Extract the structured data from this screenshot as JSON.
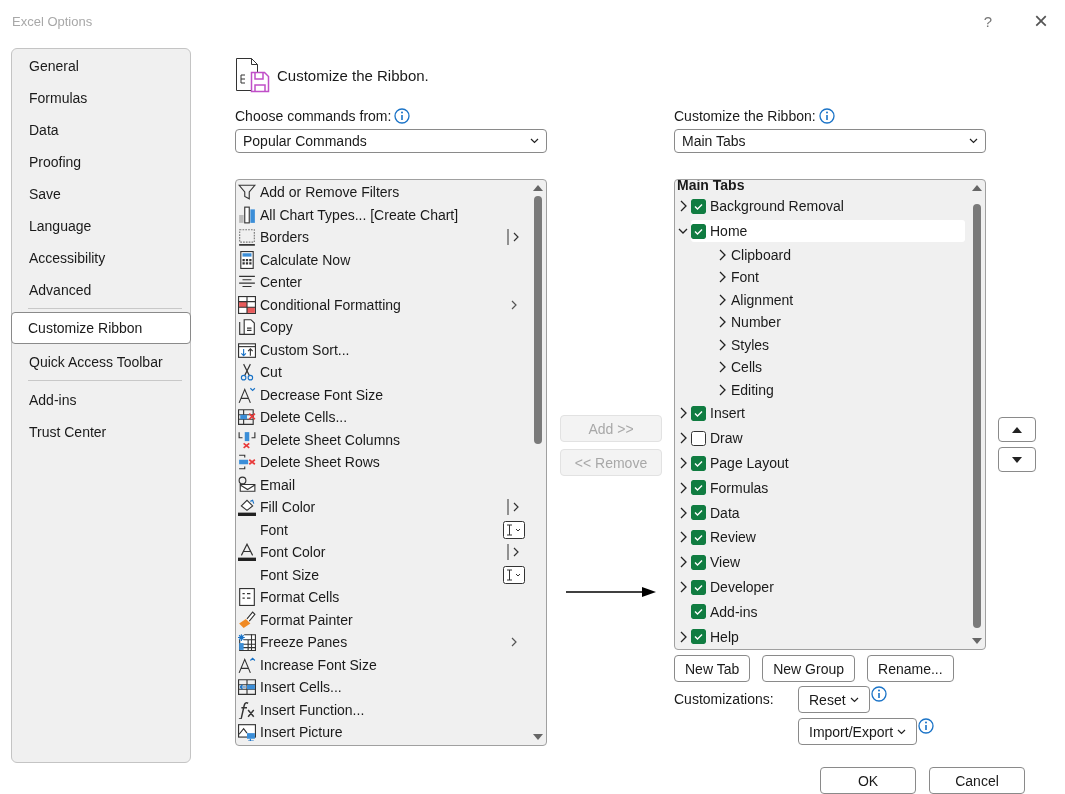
{
  "window": {
    "title": "Excel Options",
    "help": "?",
    "close": "×"
  },
  "sidebar": {
    "groups": [
      [
        {
          "label": "General",
          "selected": false
        },
        {
          "label": "Formulas",
          "selected": false
        },
        {
          "label": "Data",
          "selected": false
        },
        {
          "label": "Proofing",
          "selected": false
        },
        {
          "label": "Save",
          "selected": false
        },
        {
          "label": "Language",
          "selected": false
        },
        {
          "label": "Accessibility",
          "selected": false
        },
        {
          "label": "Advanced",
          "selected": false
        }
      ],
      [
        {
          "label": "Customize Ribbon",
          "selected": true
        },
        {
          "label": "Quick Access Toolbar",
          "selected": false
        }
      ],
      [
        {
          "label": "Add-ins",
          "selected": false
        },
        {
          "label": "Trust Center",
          "selected": false
        }
      ]
    ]
  },
  "heading": "Customize the Ribbon.",
  "commands": {
    "label": "Choose commands from:",
    "dropdown": "Popular Commands",
    "items": [
      {
        "label": "Add or Remove Filters",
        "kind": "plain"
      },
      {
        "label": "All Chart Types... [Create Chart]",
        "kind": "plain"
      },
      {
        "label": "Borders",
        "kind": "split"
      },
      {
        "label": "Calculate Now",
        "kind": "plain"
      },
      {
        "label": "Center",
        "kind": "plain"
      },
      {
        "label": "Conditional Formatting",
        "kind": "submenu"
      },
      {
        "label": "Copy",
        "kind": "plain"
      },
      {
        "label": "Custom Sort...",
        "kind": "plain"
      },
      {
        "label": "Cut",
        "kind": "plain"
      },
      {
        "label": "Decrease Font Size",
        "kind": "plain"
      },
      {
        "label": "Delete Cells...",
        "kind": "plain"
      },
      {
        "label": "Delete Sheet Columns",
        "kind": "plain"
      },
      {
        "label": "Delete Sheet Rows",
        "kind": "plain"
      },
      {
        "label": "Email",
        "kind": "plain"
      },
      {
        "label": "Fill Color",
        "kind": "split"
      },
      {
        "label": "Font",
        "kind": "field"
      },
      {
        "label": "Font Color",
        "kind": "split"
      },
      {
        "label": "Font Size",
        "kind": "field"
      },
      {
        "label": "Format Cells",
        "kind": "plain"
      },
      {
        "label": "Format Painter",
        "kind": "plain"
      },
      {
        "label": "Freeze Panes",
        "kind": "submenu"
      },
      {
        "label": "Increase Font Size",
        "kind": "plain"
      },
      {
        "label": "Insert Cells...",
        "kind": "plain"
      },
      {
        "label": "Insert Function...",
        "kind": "plain"
      },
      {
        "label": "Insert Picture",
        "kind": "plain"
      }
    ]
  },
  "move": {
    "add": {
      "label": "Add >>",
      "disabled": true
    },
    "remove": {
      "label": "<< Remove",
      "disabled": true
    }
  },
  "ribbon": {
    "label": "Customize the Ribbon:",
    "dropdown": "Main Tabs",
    "tree": {
      "header": "Main Tabs",
      "items": [
        {
          "label": "Background Removal",
          "checked": true,
          "expandable": true,
          "expanded": false,
          "selected": false
        },
        {
          "label": "Home",
          "checked": true,
          "expandable": true,
          "expanded": true,
          "selected": true,
          "children": [
            {
              "label": "Clipboard",
              "expanded": false
            },
            {
              "label": "Font",
              "expanded": false
            },
            {
              "label": "Alignment",
              "expanded": false
            },
            {
              "label": "Number",
              "expanded": false
            },
            {
              "label": "Styles",
              "expanded": false
            },
            {
              "label": "Cells",
              "expanded": false
            },
            {
              "label": "Editing",
              "expanded": false
            }
          ]
        },
        {
          "label": "Insert",
          "checked": true,
          "expandable": true,
          "expanded": false,
          "selected": false
        },
        {
          "label": "Draw",
          "checked": false,
          "expandable": true,
          "expanded": false,
          "selected": false
        },
        {
          "label": "Page Layout",
          "checked": true,
          "expandable": true,
          "expanded": false,
          "selected": false
        },
        {
          "label": "Formulas",
          "checked": true,
          "expandable": true,
          "expanded": false,
          "selected": false
        },
        {
          "label": "Data",
          "checked": true,
          "expandable": true,
          "expanded": false,
          "selected": false
        },
        {
          "label": "Review",
          "checked": true,
          "expandable": true,
          "expanded": false,
          "selected": false
        },
        {
          "label": "View",
          "checked": true,
          "expandable": true,
          "expanded": false,
          "selected": false
        },
        {
          "label": "Developer",
          "checked": true,
          "expandable": true,
          "expanded": false,
          "selected": false
        },
        {
          "label": "Add-ins",
          "checked": true,
          "expandable": false,
          "expanded": false,
          "selected": false
        },
        {
          "label": "Help",
          "checked": true,
          "expandable": true,
          "expanded": false,
          "selected": false
        }
      ]
    },
    "buttons": [
      {
        "label": "New Tab"
      },
      {
        "label": "New Group"
      },
      {
        "label": "Rename..."
      }
    ],
    "customizations": {
      "label": "Customizations:",
      "reset": {
        "label": "Reset"
      },
      "import_export": {
        "label": "Import/Export"
      }
    }
  },
  "footer": [
    {
      "label": "OK"
    },
    {
      "label": "Cancel"
    }
  ]
}
